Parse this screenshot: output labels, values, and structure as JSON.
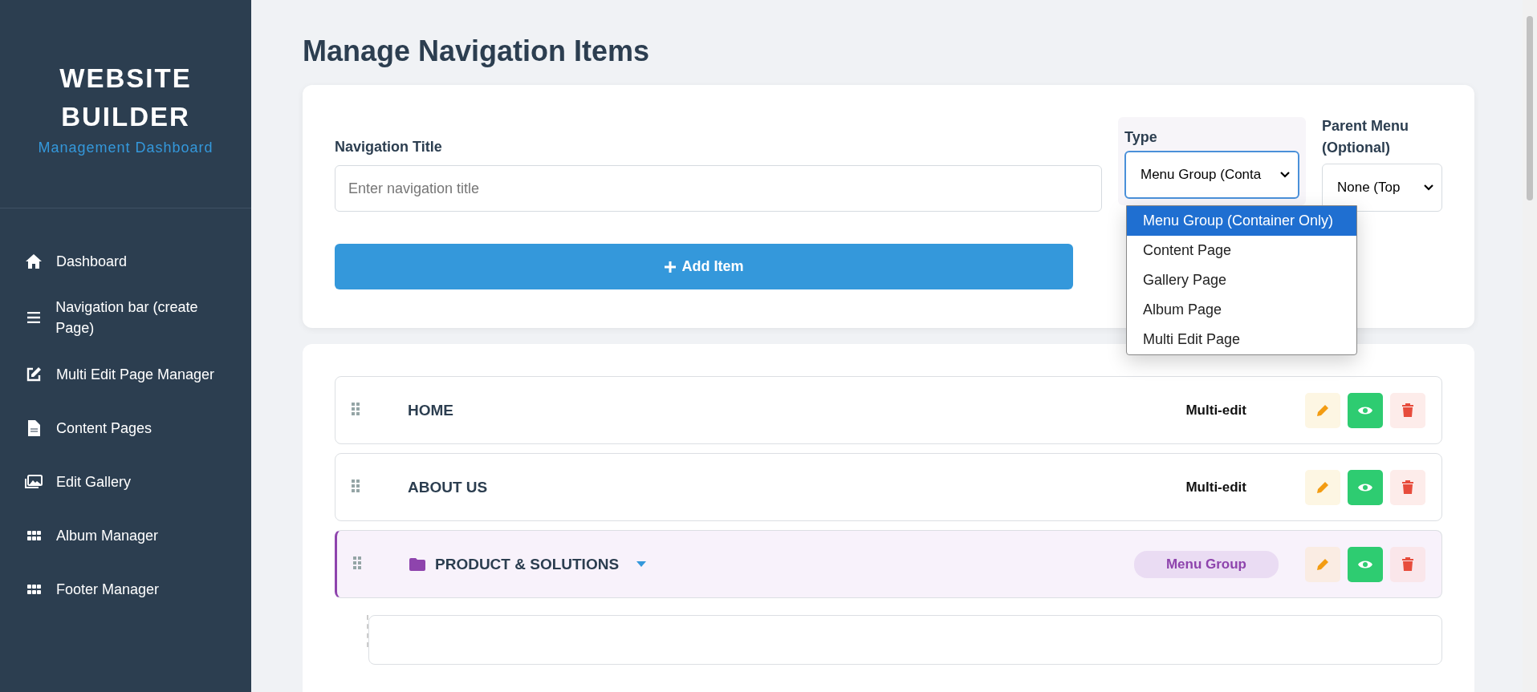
{
  "sidebar": {
    "title": "WEBSITE BUILDER",
    "subtitle": "Management Dashboard",
    "items": [
      {
        "label": "Dashboard"
      },
      {
        "label": "Navigation bar (create Page)"
      },
      {
        "label": "Multi Edit Page Manager"
      },
      {
        "label": "Content Pages"
      },
      {
        "label": "Edit Gallery"
      },
      {
        "label": "Album Manager"
      },
      {
        "label": "Footer Manager"
      }
    ]
  },
  "page_title": "Manage Navigation Items",
  "form": {
    "title_field": {
      "label": "Navigation Title",
      "placeholder": "Enter navigation title"
    },
    "type": {
      "label": "Type",
      "value": "Menu Group (Conta",
      "expanded": true,
      "options": [
        {
          "label": "Menu Group (Container Only)",
          "selected": true
        },
        {
          "label": "Content Page",
          "selected": false
        },
        {
          "label": "Gallery Page",
          "selected": false
        },
        {
          "label": "Album Page",
          "selected": false
        },
        {
          "label": "Multi Edit Page",
          "selected": false
        }
      ]
    },
    "parent": {
      "label": "Parent Menu (Optional)",
      "value": "None (Top"
    },
    "add_button": "Add Item"
  },
  "nav_items": [
    {
      "kind": "page",
      "title": "HOME",
      "badge": "Multi-edit"
    },
    {
      "kind": "page",
      "title": "ABOUT US",
      "badge": "Multi-edit"
    },
    {
      "kind": "group",
      "title": "PRODUCT & SOLUTIONS",
      "badge": "Menu Group",
      "expanded": true
    }
  ]
}
